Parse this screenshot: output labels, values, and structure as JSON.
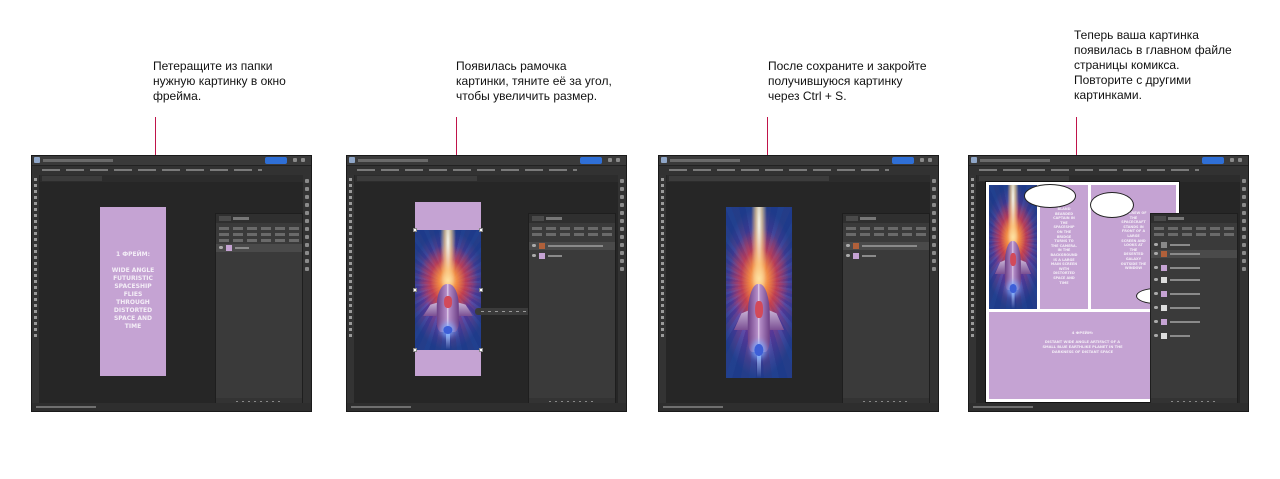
{
  "captions": [
    "Петеращите из папки\nнужную картинку в окно\nфрейма.",
    "Появилась рамочка\nкартинки, тяните её за угол,\nчтобы увеличить размер.",
    "После сохраните и закройте\nполучившуюся картинку\nчерез Ctrl + S.",
    "Теперь ваша картинка\nпоявилась в главном файле\nстраницы комикса.\nПовторите с другими\nкартинками."
  ],
  "frame1_text": "1 фрейм:\n\nwide angle\nfuturistic\nspaceship\nflies\nthrough\ndistorted\nspace and\ntime",
  "comic": {
    "panel_text_1": "Bland\nbearded\ncaptain in\nthe\nspaceship\non the\nbridge\nturns to\nthe camera.\nIn the\nbackground\nis a large\nmain screen\nwith\ndistorted\nspace and\ntime",
    "panel_text_2": "The crew of\nthe\nspacecraft\nstands in\nfront of a\nlarge\nscreen and\nlooks at\nthe\ndeserted\ngalaxy\noutside the\nwindow",
    "frame4_title": "4 фрейм:",
    "frame4_text": "distant wide angle artifact of a\nsmall blue earthlike planet in the\ndarkness of distant space"
  },
  "colors": {
    "accent_line": "#c0144a",
    "frame_fill": "#c5a3d3",
    "ps_bg": "#262626",
    "share_button": "#2f6fd6"
  },
  "icons": [
    "photoshop-logo-icon",
    "share-icon",
    "search-icon",
    "eye-icon",
    "layer-thumbnail-icon"
  ]
}
